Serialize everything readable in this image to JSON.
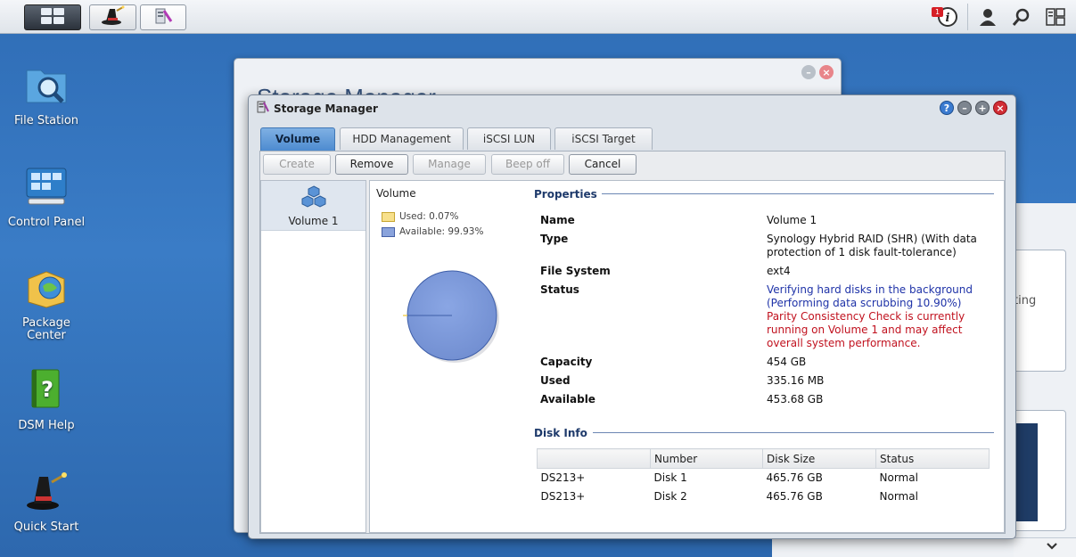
{
  "taskbar": {
    "notification_count": "1"
  },
  "desktop": {
    "icons": [
      {
        "label": "File Station"
      },
      {
        "label": "Control Panel"
      },
      {
        "label": "Package Center"
      },
      {
        "label": "DSM Help"
      },
      {
        "label": "Quick Start"
      }
    ]
  },
  "background_window": {
    "title": "Storage Manager",
    "partial_text": "ting"
  },
  "window": {
    "title": "Storage Manager",
    "tabs": [
      {
        "label": "Volume",
        "active": true
      },
      {
        "label": "HDD Management",
        "active": false
      },
      {
        "label": "iSCSI LUN",
        "active": false
      },
      {
        "label": "iSCSI Target",
        "active": false
      }
    ],
    "toolbar": {
      "create": "Create",
      "remove": "Remove",
      "manage": "Manage",
      "beep_off": "Beep off",
      "cancel": "Cancel"
    },
    "volume_list": [
      {
        "label": "Volume 1"
      }
    ],
    "chart_header": "Volume",
    "legend": {
      "used": "Used: 0.07%",
      "available": "Available: 99.93%"
    },
    "usage": {
      "used_percent": 0.07,
      "available_percent": 99.93,
      "used_color": "#f5dc7a",
      "available_color": "#7b97d6"
    },
    "properties": {
      "section_title": "Properties",
      "name_label": "Name",
      "name_value": "Volume 1",
      "type_label": "Type",
      "type_value": "Synology Hybrid RAID (SHR) (With data protection of 1 disk fault-tolerance)",
      "fs_label": "File System",
      "fs_value": "ext4",
      "status_label": "Status",
      "status_line1": "Verifying hard disks in the background",
      "status_line2": "(Performing data scrubbing 10.90%)",
      "status_warning": "Parity Consistency Check is currently running on Volume 1 and may affect overall system performance.",
      "capacity_label": "Capacity",
      "capacity_value": "454 GB",
      "used_label": "Used",
      "used_value": "335.16 MB",
      "available_label": "Available",
      "available_value": "453.68 GB"
    },
    "disk_info": {
      "section_title": "Disk Info",
      "columns": [
        "",
        "Number",
        "Disk Size",
        "Status"
      ],
      "rows": [
        {
          "model": "DS213+",
          "number": "Disk 1",
          "size": "465.76 GB",
          "status": "Normal"
        },
        {
          "model": "DS213+",
          "number": "Disk 2",
          "size": "465.76 GB",
          "status": "Normal"
        }
      ]
    }
  }
}
